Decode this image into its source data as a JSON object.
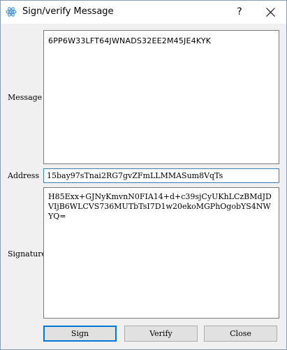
{
  "window": {
    "title": "Sign/verify Message",
    "help_label": "?",
    "app_icon": "qt-atom-icon",
    "close_icon": "close-x-icon"
  },
  "form": {
    "message_label": "Message",
    "message_value": "6PP6W33LFT64JWNADS32EE2M45JE4KYK",
    "address_label": "Address",
    "address_value": "15bay97sTnai2RG7gvZFmLLMMASum8VqTs",
    "signature_label": "Signature",
    "signature_value": "H85Exx+GJNyKmvnN0FIA14+d+c39sjCyUKhLCzBMdJDVIjB6WLCVS736MUTbTsI7D1w20ekoMGPhOgobYS4NWYQ="
  },
  "buttons": {
    "sign": "Sign",
    "verify": "Verify",
    "close": "Close"
  },
  "colors": {
    "focus_border": "#0078d7",
    "address_border": "#3c7fb1",
    "dialog_background": "#f0f0f0"
  }
}
